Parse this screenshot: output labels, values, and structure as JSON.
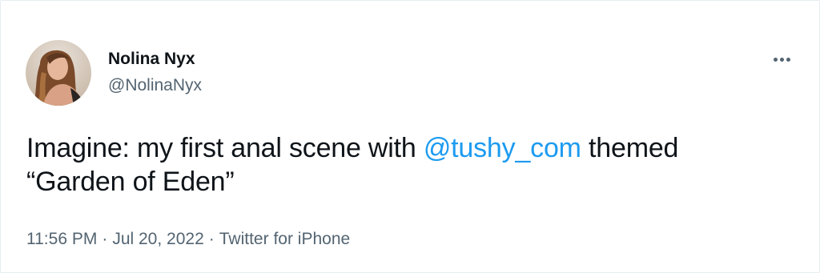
{
  "tweet": {
    "author": {
      "display_name": "Nolina Nyx",
      "handle": "@NolinaNyx",
      "avatar_icon": "profile-photo"
    },
    "more_icon": "more-options-icon",
    "text_part1": "Imagine: my first anal scene with ",
    "mention": "@tushy_com",
    "text_part2": " themed",
    "text_line2": "“Garden of Eden”",
    "time": "11:56 PM",
    "date": "Jul 20, 2022",
    "source": "Twitter for iPhone",
    "separator": "·"
  },
  "colors": {
    "link": "#1d9bf0",
    "secondary_text": "#536471",
    "primary_text": "#0f1419",
    "border": "#e6ecf0"
  }
}
